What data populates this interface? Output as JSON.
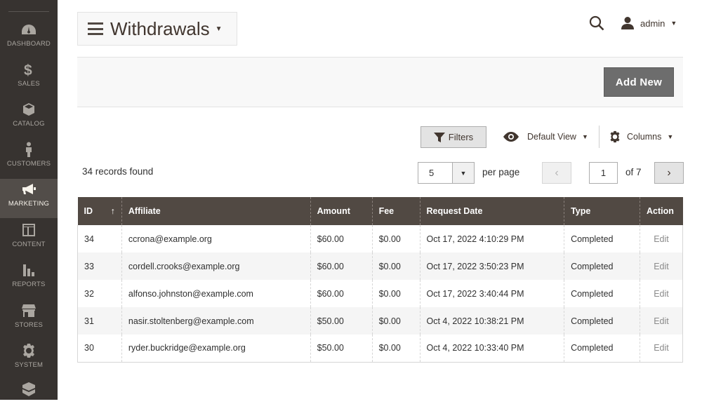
{
  "sidebar": {
    "items": [
      {
        "label": "DASHBOARD",
        "icon": "dashboard-icon"
      },
      {
        "label": "SALES",
        "icon": "dollar-icon"
      },
      {
        "label": "CATALOG",
        "icon": "cube-icon"
      },
      {
        "label": "CUSTOMERS",
        "icon": "person-icon"
      },
      {
        "label": "MARKETING",
        "icon": "megaphone-icon",
        "active": true
      },
      {
        "label": "CONTENT",
        "icon": "layout-icon"
      },
      {
        "label": "REPORTS",
        "icon": "bar-chart-icon"
      },
      {
        "label": "STORES",
        "icon": "storefront-icon"
      },
      {
        "label": "SYSTEM",
        "icon": "gear-icon"
      },
      {
        "label": "",
        "icon": "extensions-icon"
      }
    ]
  },
  "header": {
    "title": "Withdrawals",
    "user": "admin"
  },
  "actions": {
    "add_new": "Add New"
  },
  "toolbar": {
    "filters": "Filters",
    "view": "Default View",
    "columns": "Columns",
    "records": "34 records found",
    "per_page_value": "5",
    "per_page_label": "per page",
    "page": "1",
    "of_pages": "of 7"
  },
  "table": {
    "columns": [
      "ID",
      "Affiliate",
      "Amount",
      "Fee",
      "Request Date",
      "Type",
      "Action"
    ],
    "sort_indicator": "↑",
    "rows": [
      {
        "id": "34",
        "affiliate": "ccrona@example.org",
        "amount": "$60.00",
        "fee": "$0.00",
        "date": "Oct 17, 2022 4:10:29 PM",
        "type": "Completed",
        "action": "Edit"
      },
      {
        "id": "33",
        "affiliate": "cordell.crooks@example.org",
        "amount": "$60.00",
        "fee": "$0.00",
        "date": "Oct 17, 2022 3:50:23 PM",
        "type": "Completed",
        "action": "Edit"
      },
      {
        "id": "32",
        "affiliate": "alfonso.johnston@example.com",
        "amount": "$60.00",
        "fee": "$0.00",
        "date": "Oct 17, 2022 3:40:44 PM",
        "type": "Completed",
        "action": "Edit"
      },
      {
        "id": "31",
        "affiliate": "nasir.stoltenberg@example.com",
        "amount": "$50.00",
        "fee": "$0.00",
        "date": "Oct 4, 2022 10:38:21 PM",
        "type": "Completed",
        "action": "Edit"
      },
      {
        "id": "30",
        "affiliate": "ryder.buckridge@example.org",
        "amount": "$50.00",
        "fee": "$0.00",
        "date": "Oct 4, 2022 10:33:40 PM",
        "type": "Completed",
        "action": "Edit"
      }
    ]
  }
}
